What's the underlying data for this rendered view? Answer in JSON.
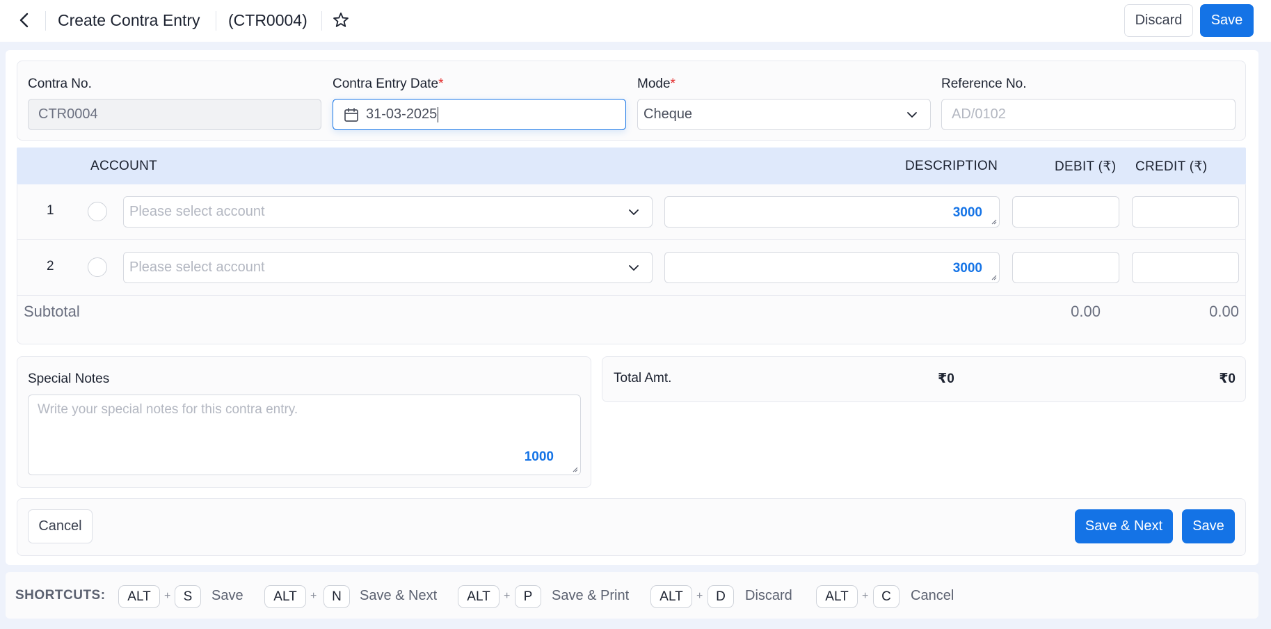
{
  "header": {
    "title": "Create Contra Entry",
    "code": "(CTR0004)",
    "discard_label": "Discard",
    "save_label": "Save"
  },
  "form": {
    "contra_no": {
      "label": "Contra No.",
      "value": "CTR0004"
    },
    "entry_date": {
      "label": "Contra Entry Date",
      "required_mark": "*",
      "value": "31-03-2025"
    },
    "mode": {
      "label": "Mode",
      "required_mark": "*",
      "value": "Cheque"
    },
    "reference": {
      "label": "Reference No.",
      "placeholder": "AD/0102"
    }
  },
  "table": {
    "headers": {
      "account": "ACCOUNT",
      "description": "DESCRIPTION",
      "debit": "DEBIT (₹)",
      "credit": "CREDIT (₹)"
    },
    "rows": [
      {
        "num": "1",
        "account_placeholder": "Please select account",
        "description_counter": "3000"
      },
      {
        "num": "2",
        "account_placeholder": "Please select account",
        "description_counter": "3000"
      }
    ],
    "subtotal": {
      "label": "Subtotal",
      "debit": "0.00",
      "credit": "0.00"
    }
  },
  "notes": {
    "label": "Special Notes",
    "placeholder": "Write your special notes for this contra entry.",
    "counter": "1000"
  },
  "totals": {
    "label": "Total Amt.",
    "debit": "₹0",
    "credit": "₹0"
  },
  "footer": {
    "cancel_label": "Cancel",
    "save_next_label": "Save & Next",
    "save_label": "Save"
  },
  "shortcuts": {
    "title": "SHORTCUTS:",
    "items": [
      {
        "modifier": "ALT",
        "key": "S",
        "label": "Save"
      },
      {
        "modifier": "ALT",
        "key": "N",
        "label": "Save & Next"
      },
      {
        "modifier": "ALT",
        "key": "P",
        "label": "Save & Print"
      },
      {
        "modifier": "ALT",
        "key": "D",
        "label": "Discard"
      },
      {
        "modifier": "ALT",
        "key": "C",
        "label": "Cancel"
      }
    ]
  },
  "colors": {
    "primary": "#1473e6",
    "required": "#e32b2b",
    "table_header": "#dfe9fb",
    "page_bg": "#eef2fb"
  }
}
